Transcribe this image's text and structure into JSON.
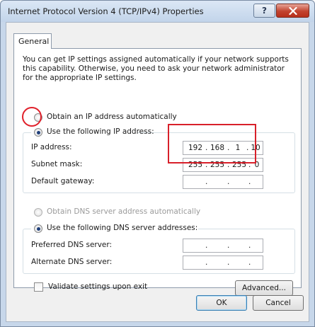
{
  "window": {
    "title": "Internet Protocol Version 4 (TCP/IPv4) Properties",
    "help_glyph": "?",
    "close_icon": "close-icon"
  },
  "tabs": [
    {
      "label": "General"
    }
  ],
  "description": "You can get IP settings assigned automatically if your network supports this capability. Otherwise, you need to ask your network administrator for the appropriate IP settings.",
  "ip_mode": {
    "auto_label": "Obtain an IP address automatically",
    "manual_label": "Use the following IP address:",
    "selected": "manual"
  },
  "ip_fields": {
    "ip_label": "IP address:",
    "ip_value": [
      "192",
      "168",
      "1",
      "10"
    ],
    "subnet_label": "Subnet mask:",
    "subnet_value": [
      "255",
      "255",
      "255",
      "0"
    ],
    "gateway_label": "Default gateway:",
    "gateway_value": [
      "",
      "",
      "",
      ""
    ]
  },
  "dns_mode": {
    "auto_label": "Obtain DNS server address automatically",
    "manual_label": "Use the following DNS server addresses:",
    "selected": "manual"
  },
  "dns_fields": {
    "preferred_label": "Preferred DNS server:",
    "alternate_label": "Alternate DNS server:"
  },
  "validate": {
    "label": "Validate settings upon exit",
    "checked": false
  },
  "buttons": {
    "advanced": "Advanced...",
    "ok": "OK",
    "cancel": "Cancel"
  },
  "colors": {
    "highlight": "#e0202a",
    "titlebar": "#c7d7ea",
    "close_button": "#c2432f"
  }
}
